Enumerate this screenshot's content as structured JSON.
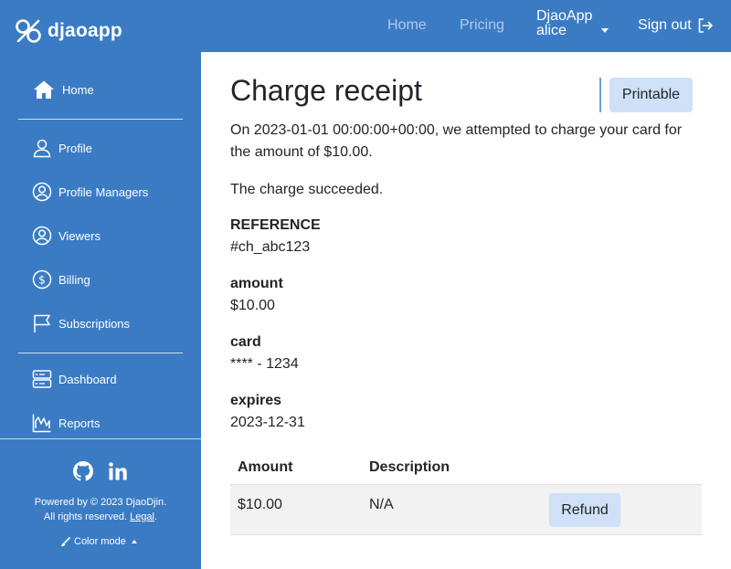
{
  "header": {
    "brand": "djaoapp",
    "nav": {
      "home": "Home",
      "pricing": "Pricing"
    },
    "user": {
      "org": "DjaoApp",
      "name": "alice"
    },
    "signout": "Sign out"
  },
  "sidebar": {
    "items": [
      {
        "label": "Home",
        "icon": "house-icon"
      },
      {
        "label": "Profile",
        "icon": "person-icon"
      },
      {
        "label": "Profile Managers",
        "icon": "person-circle-icon"
      },
      {
        "label": "Viewers",
        "icon": "person-circle-icon"
      },
      {
        "label": "Billing",
        "icon": "dollar-circle-icon"
      },
      {
        "label": "Subscriptions",
        "icon": "flag-icon"
      },
      {
        "label": "Dashboard",
        "icon": "server-icon"
      },
      {
        "label": "Reports",
        "icon": "chart-icon"
      }
    ],
    "footer": {
      "powered_prefix": "Powered by © 2023 DjaoDjin.",
      "rights": "All rights reserved.",
      "legal": "Legal",
      "rights_suffix": ".",
      "color_mode": "Color mode"
    }
  },
  "main": {
    "title": "Charge receipt",
    "printable_label": "Printable",
    "intro": "On 2023-01-01 00:00:00+00:00, we attempted to charge your card for the amount of $10.00.",
    "status": "The charge succeeded.",
    "fields": [
      {
        "label": "REFERENCE",
        "value": "#ch_abc123"
      },
      {
        "label": "amount",
        "value": "$10.00"
      },
      {
        "label": "card",
        "value": "**** - 1234"
      },
      {
        "label": "expires",
        "value": "2023-12-31"
      }
    ],
    "table": {
      "headers": [
        "Amount",
        "Description"
      ],
      "rows": [
        {
          "amount": "$10.00",
          "description": "N/A",
          "action": "Refund"
        }
      ]
    }
  },
  "colors": {
    "primary": "#3b7bc4",
    "button_bg": "#cfe0f7"
  }
}
